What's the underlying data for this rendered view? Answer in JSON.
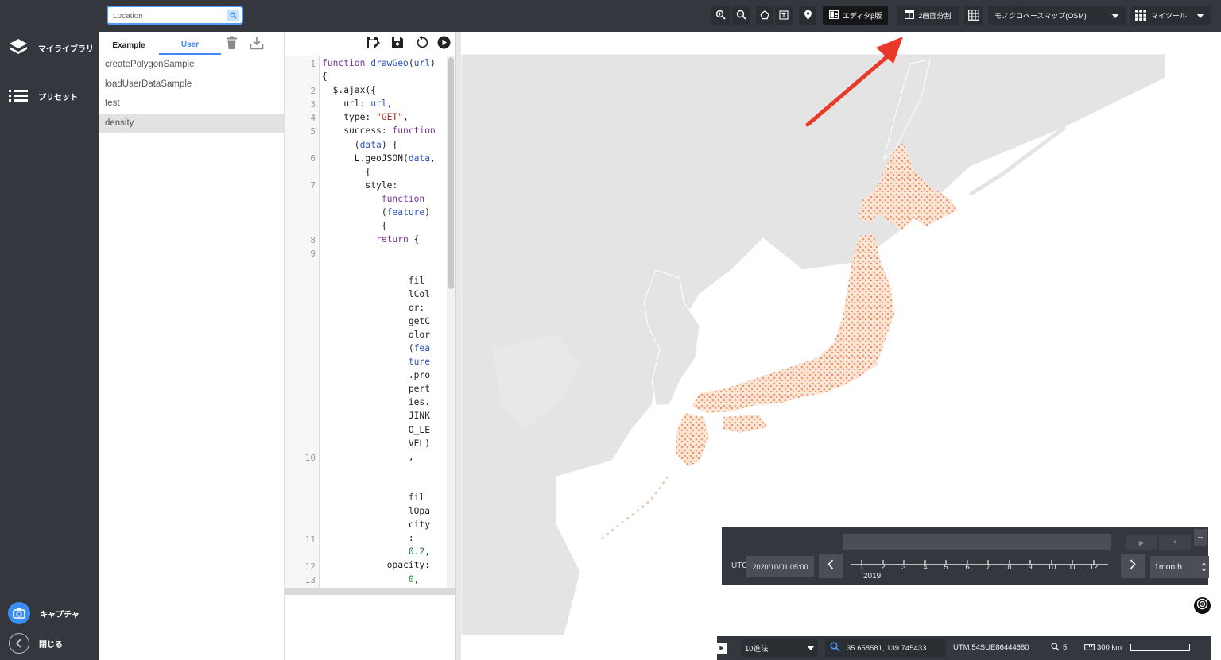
{
  "sidebar": {
    "items": [
      {
        "label": "マイライブラリ",
        "icon": "layers-icon"
      },
      {
        "label": "プリセット",
        "icon": "list-icon"
      }
    ],
    "capture_label": "キャプチャ",
    "close_label": "閉じる"
  },
  "header": {
    "search_placeholder": "Location",
    "editor_beta_label": "エディタβ版",
    "split_screen_label": "2画面分割",
    "basemap_value": "モノクロベースマップ(OSM)",
    "mytools_label": "マイツール"
  },
  "file_panel": {
    "tabs": [
      {
        "label": "Example",
        "active": false
      },
      {
        "label": "User",
        "active": true
      }
    ],
    "files": [
      {
        "name": "createPolygonSample",
        "selected": false
      },
      {
        "name": "loadUserDataSample",
        "selected": false
      },
      {
        "name": "test",
        "selected": false
      },
      {
        "name": "density",
        "selected": true
      }
    ]
  },
  "editor": {
    "line_numbers": [
      "1",
      "2",
      "3",
      "4",
      "5",
      "6",
      "7",
      "8",
      "9",
      "10",
      "11",
      "12",
      "13"
    ]
  },
  "timeline": {
    "timezone_label": "UTC",
    "datetime_value": "2020/10/01 05:00",
    "ticks": [
      "1",
      "2",
      "3",
      "4",
      "5",
      "6",
      "7",
      "8",
      "9",
      "10",
      "11",
      "12"
    ],
    "year_label": "2019",
    "interval_value": "1month",
    "play_glyph": "▶",
    "pause_glyph": "⏸",
    "minimize_glyph": "−"
  },
  "statusbar": {
    "coord_format": "10進法",
    "coordinates": "35.658581, 139.745433",
    "utm": "UTM:54SUE86444680",
    "zoom_level": "5",
    "scale_label": "300 km"
  },
  "colors": {
    "chrome_dark": "#34383e",
    "accent_blue": "#3d8af7",
    "annotation_red": "#e8392a",
    "land_gray": "#e6e6e6",
    "density_orange": "#f08a5a"
  }
}
